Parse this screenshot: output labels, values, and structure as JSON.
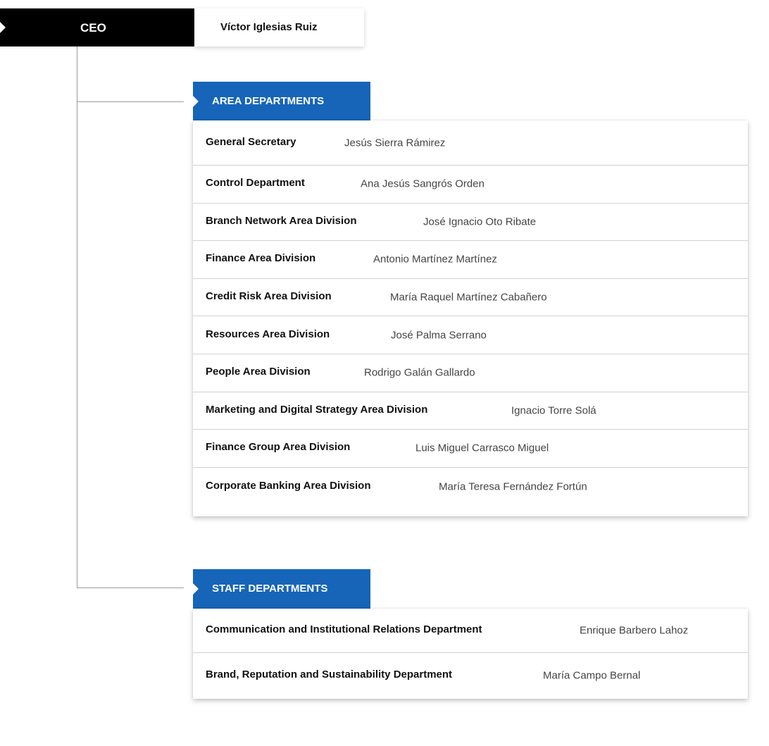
{
  "ceo": {
    "title": "CEO",
    "name": "Víctor Iglesias Ruiz"
  },
  "area": {
    "heading": "AREA DEPARTMENTS",
    "rows": [
      {
        "dept": "General Secretary",
        "person": "Jesús Sierra Rámirez"
      },
      {
        "dept": "Control Department",
        "person": "Ana Jesús Sangrós Orden"
      },
      {
        "dept": "Branch Network Area Division",
        "person": "José Ignacio Oto Ribate"
      },
      {
        "dept": "Finance Area Division",
        "person": "Antonio Martínez Martínez"
      },
      {
        "dept": "Credit Risk Area Division",
        "person": "María Raquel Martínez Cabañero"
      },
      {
        "dept": "Resources Area Division",
        "person": "José Palma Serrano"
      },
      {
        "dept": "People Area Division",
        "person": "Rodrigo Galán Gallardo"
      },
      {
        "dept": "Marketing and Digital Strategy Area Division",
        "person": "Ignacio Torre Solá"
      },
      {
        "dept": "Finance Group Area Division",
        "person": "Luis Miguel Carrasco Miguel"
      },
      {
        "dept": "Corporate Banking Area Division",
        "person": "María Teresa Fernández Fortún"
      }
    ]
  },
  "staff": {
    "heading": "STAFF DEPARTMENTS",
    "rows": [
      {
        "dept": "Communication and Institutional Relations Department",
        "person": "Enrique Barbero Lahoz"
      },
      {
        "dept": "Brand, Reputation and Sustainability Department",
        "person": "María Campo Bernal"
      }
    ]
  },
  "colors": {
    "ceo_tab": "#000000",
    "section_tab": "#1665b8",
    "connector": "#9a9a9a"
  }
}
